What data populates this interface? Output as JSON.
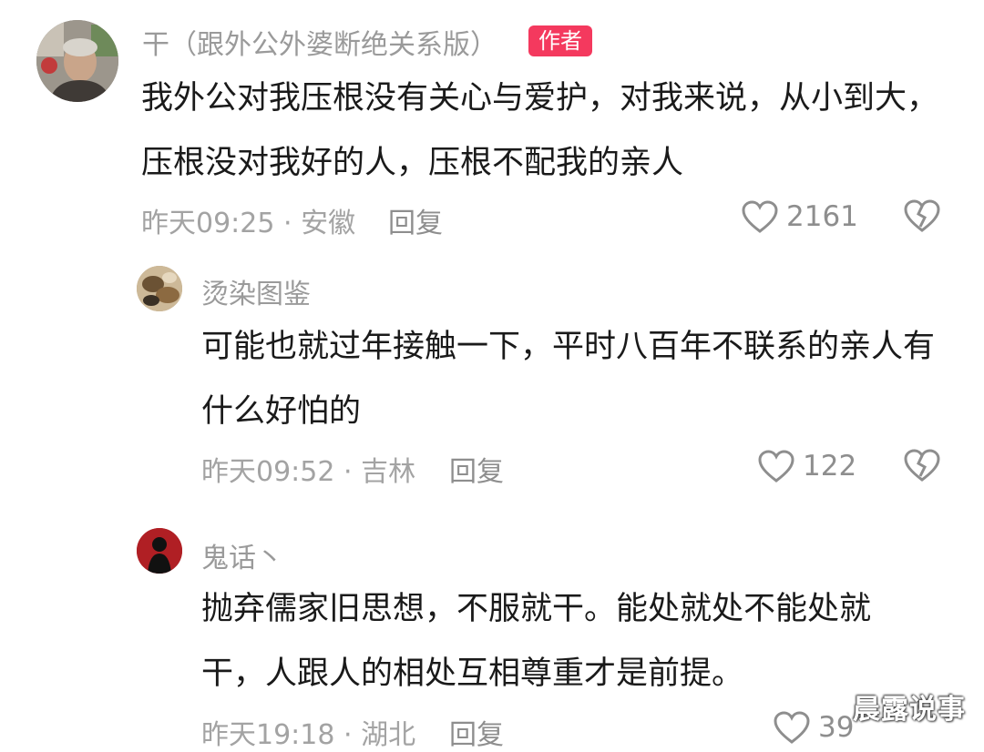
{
  "comments": [
    {
      "username": "干（跟外公外婆断绝关系版）",
      "badge": "作者",
      "text": "我外公对我压根没有关心与爱护，对我来说，从小到大，压根没对我好的人，压根不配我的亲人",
      "time_location": "昨天09:25 · 安徽",
      "reply_label": "回复",
      "likes": "2161"
    },
    {
      "username": "烫染图鉴",
      "text": "可能也就过年接触一下，平时八百年不联系的亲人有什么好怕的",
      "time_location": "昨天09:52 · 吉林",
      "reply_label": "回复",
      "likes": "122"
    },
    {
      "username": "鬼话丶",
      "text": "抛弃儒家旧思想，不服就干。能处就处不能处就干，人跟人的相处互相尊重才是前提。",
      "time_location": "昨天19:18 · 湖北",
      "reply_label": "回复",
      "likes": "39"
    }
  ],
  "watermark": "晨露说事",
  "icons": {
    "like": "heart-outline-icon",
    "dislike": "broken-heart-icon"
  },
  "colors": {
    "author_badge": "#f4395e",
    "username": "#9a9a9a",
    "body_text": "#1a1a1a",
    "meta": "#a3a3a3"
  }
}
